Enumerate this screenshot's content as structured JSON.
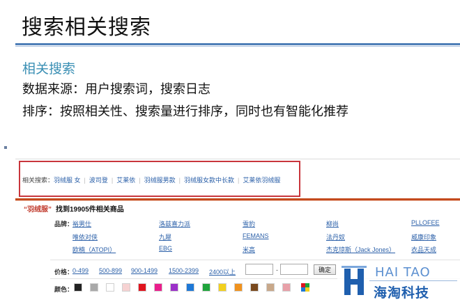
{
  "slide": {
    "title": "搜索相关搜索",
    "subheading": "相关搜索",
    "line1": "数据来源：用户搜索词，搜索日志",
    "line2": "排序：按照相关性、搜索量进行排序，同时也有智能化推荐"
  },
  "related": {
    "label": "相关搜索：",
    "items": [
      "羽绒服 女",
      "波司登",
      "艾莱依",
      "羽绒服男款",
      "羽绒服女款中长款",
      "艾莱依羽绒服"
    ]
  },
  "results": {
    "keyword": "“羽绒服”",
    "count_text": "找到19905件相关商品"
  },
  "brands": {
    "label": "品牌：",
    "items": [
      "裕男仕",
      "洛兹喜力派",
      "雪豹",
      "柳尚",
      "PLLOFEE",
      "唯依对侠",
      "九犀",
      "FEMANS",
      "法丹奴",
      "威康印象",
      "欧楠（ATOPI）",
      "EBG",
      "米高",
      "杰克琼斯（Jack Jones）",
      "衣品天成"
    ]
  },
  "price": {
    "label": "价格：",
    "ranges": [
      "0-499",
      "500-899",
      "900-1499",
      "1500-2399",
      "2400以上"
    ],
    "dash": "-",
    "confirm_label": "确定"
  },
  "colors": {
    "label": "颜色：",
    "swatches": [
      "#222222",
      "#a9a9a9",
      "#ffffff",
      "#f6d2d2",
      "#e0141e",
      "#ea1e8c",
      "#9b30c8",
      "#1e78d6",
      "#1fa43c",
      "#f2d01e",
      "#f0921e",
      "#7a4a1e",
      "#c8a88a",
      "#e8a0a8"
    ],
    "more_icon": "multicolor-icon"
  },
  "logo": {
    "en": "HAI TAO",
    "cn": "海淘科技",
    "mark_color": "#1f5fae"
  }
}
